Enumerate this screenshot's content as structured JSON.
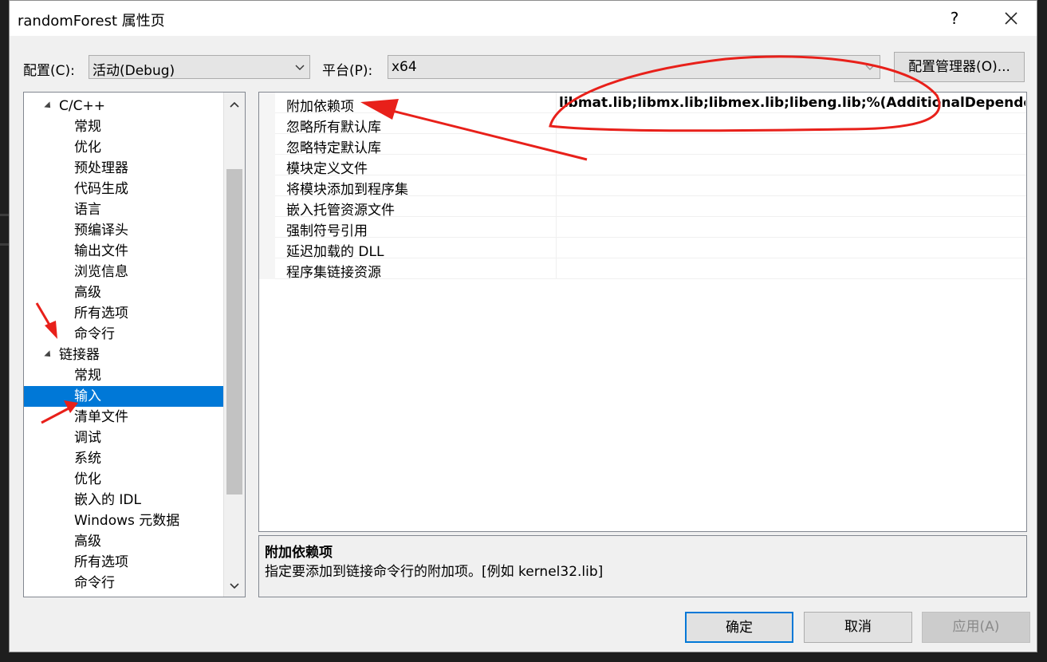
{
  "dialog": {
    "title": "randomForest 属性页",
    "help_label": "?"
  },
  "config": {
    "label": "配置(C):",
    "value": "活动(Debug)"
  },
  "platform": {
    "label": "平台(P):",
    "value": "x64"
  },
  "config_manager_label": "配置管理器(O)...",
  "tree": {
    "items": [
      {
        "label": "C/C++",
        "level": 0,
        "expanded": true
      },
      {
        "label": "常规",
        "level": 1
      },
      {
        "label": "优化",
        "level": 1
      },
      {
        "label": "预处理器",
        "level": 1
      },
      {
        "label": "代码生成",
        "level": 1
      },
      {
        "label": "语言",
        "level": 1
      },
      {
        "label": "预编译头",
        "level": 1
      },
      {
        "label": "输出文件",
        "level": 1
      },
      {
        "label": "浏览信息",
        "level": 1
      },
      {
        "label": "高级",
        "level": 1
      },
      {
        "label": "所有选项",
        "level": 1
      },
      {
        "label": "命令行",
        "level": 1
      },
      {
        "label": "链接器",
        "level": 0,
        "expanded": true
      },
      {
        "label": "常规",
        "level": 1
      },
      {
        "label": "输入",
        "level": 1,
        "selected": true
      },
      {
        "label": "清单文件",
        "level": 1
      },
      {
        "label": "调试",
        "level": 1
      },
      {
        "label": "系统",
        "level": 1
      },
      {
        "label": "优化",
        "level": 1
      },
      {
        "label": "嵌入的 IDL",
        "level": 1
      },
      {
        "label": "Windows 元数据",
        "level": 1
      },
      {
        "label": "高级",
        "level": 1
      },
      {
        "label": "所有选项",
        "level": 1
      },
      {
        "label": "命令行",
        "level": 1
      }
    ]
  },
  "properties": [
    {
      "name": "附加依赖项",
      "value": "libmat.lib;libmx.lib;libmex.lib;libeng.lib;%(AdditionalDependencies)"
    },
    {
      "name": "忽略所有默认库",
      "value": ""
    },
    {
      "name": "忽略特定默认库",
      "value": ""
    },
    {
      "name": "模块定义文件",
      "value": ""
    },
    {
      "name": "将模块添加到程序集",
      "value": ""
    },
    {
      "name": "嵌入托管资源文件",
      "value": ""
    },
    {
      "name": "强制符号引用",
      "value": ""
    },
    {
      "name": "延迟加载的 DLL",
      "value": ""
    },
    {
      "name": "程序集链接资源",
      "value": ""
    }
  ],
  "description": {
    "title": "附加依赖项",
    "text": "指定要添加到链接命令行的附加项。[例如 kernel32.lib]"
  },
  "buttons": {
    "ok": "确定",
    "cancel": "取消",
    "apply": "应用(A)"
  },
  "colors": {
    "selection": "#0078d7",
    "annotation": "#e8201a"
  }
}
